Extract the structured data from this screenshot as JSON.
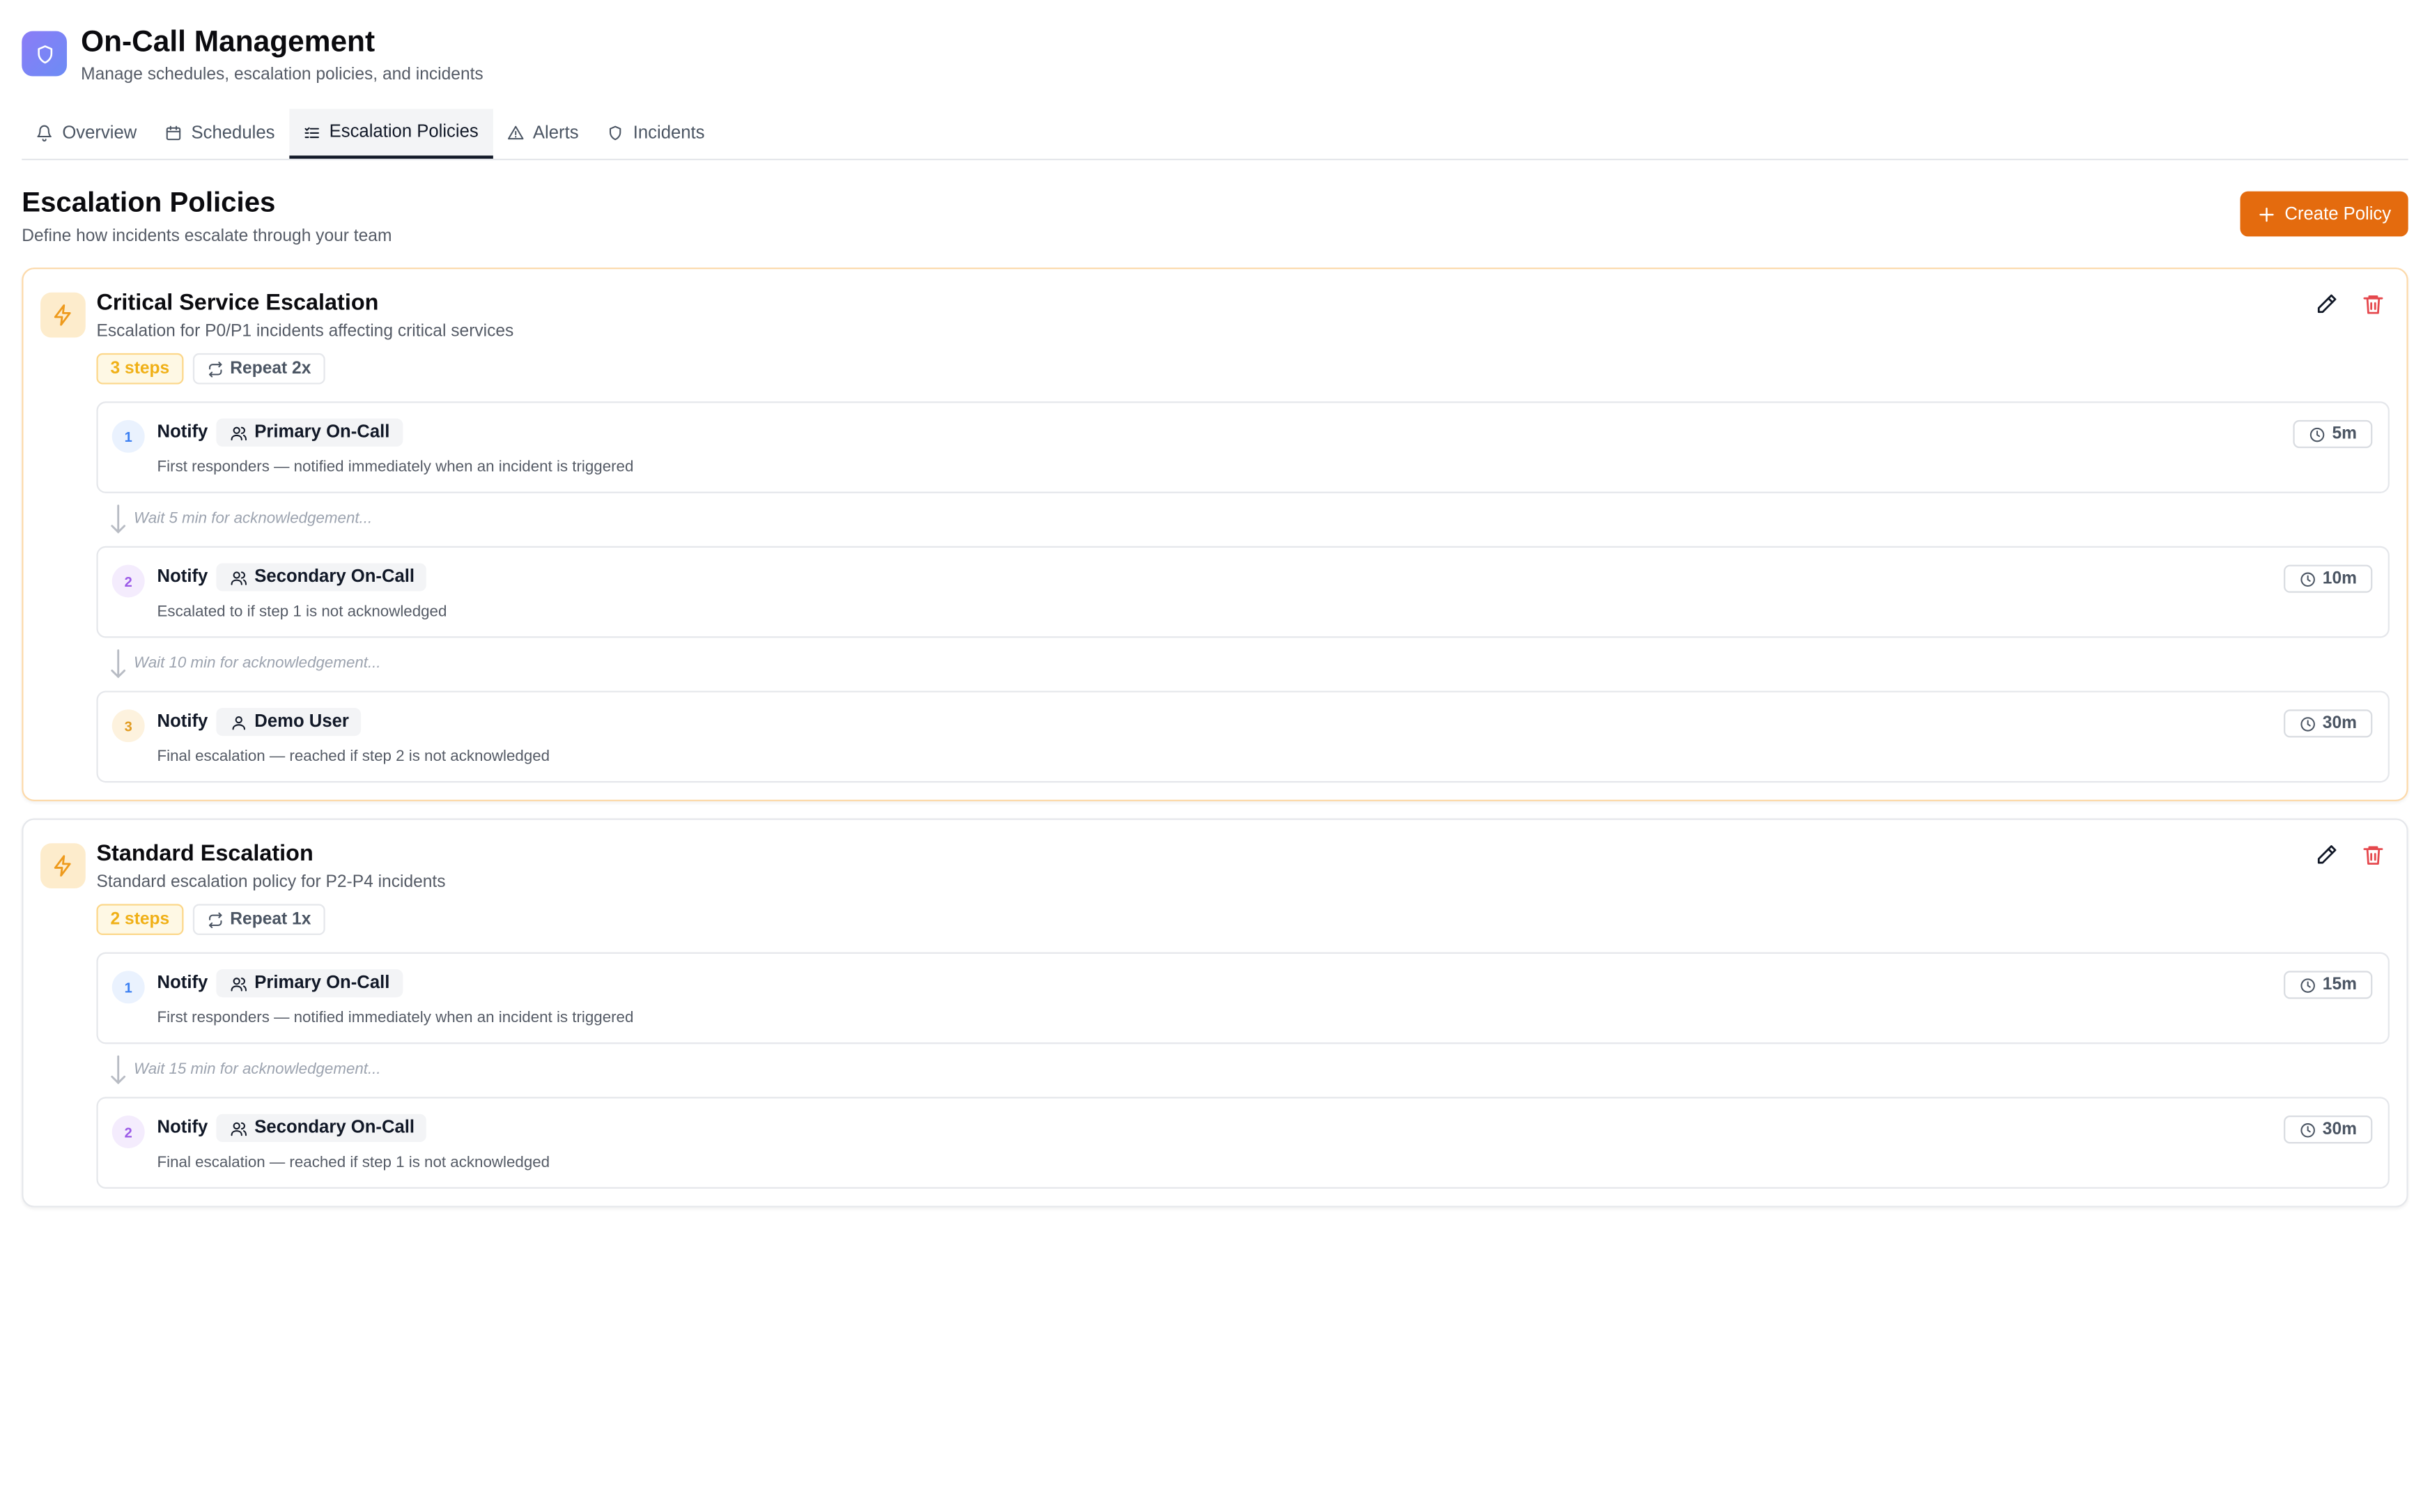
{
  "app": {
    "title": "On-Call Management",
    "subtitle": "Manage schedules, escalation policies, and incidents",
    "logo_icon": "shield-icon",
    "accent": "#e46b0e"
  },
  "tabs": [
    {
      "label": "Overview",
      "icon": "bell-icon"
    },
    {
      "label": "Schedules",
      "icon": "calendar-icon"
    },
    {
      "label": "Escalation Policies",
      "icon": "list-icon",
      "active": true
    },
    {
      "label": "Alerts",
      "icon": "warning-icon"
    },
    {
      "label": "Incidents",
      "icon": "shield-icon"
    }
  ],
  "section": {
    "title": "Escalation Policies",
    "subtitle": "Define how incidents escalate through your team",
    "create_label": "Create Policy"
  },
  "policies": [
    {
      "name": "Critical Service Escalation",
      "description": "Escalation for P0/P1 incidents affecting critical services",
      "steps_badge": "3 steps",
      "repeat_badge": "Repeat 2x",
      "steps": [
        {
          "num": "1",
          "action": "Notify",
          "target": "Primary On-Call",
          "target_icon": "users-icon",
          "desc": "First responders — notified immediately when an incident is triggered",
          "time": "5m"
        },
        {
          "wait": "Wait 5 min for acknowledgement..."
        },
        {
          "num": "2",
          "action": "Notify",
          "target": "Secondary On-Call",
          "target_icon": "users-icon",
          "desc": "Escalated to if step 1 is not acknowledged",
          "time": "10m"
        },
        {
          "wait": "Wait 10 min for acknowledgement..."
        },
        {
          "num": "3",
          "action": "Notify",
          "target": "Demo User",
          "target_icon": "user-icon",
          "desc": "Final escalation — reached if step 2 is not acknowledged",
          "time": "30m"
        }
      ]
    },
    {
      "name": "Standard Escalation",
      "description": "Standard escalation policy for P2-P4 incidents",
      "steps_badge": "2 steps",
      "repeat_badge": "Repeat 1x",
      "steps": [
        {
          "num": "1",
          "action": "Notify",
          "target": "Primary On-Call",
          "target_icon": "users-icon",
          "desc": "First responders — notified immediately when an incident is triggered",
          "time": "15m"
        },
        {
          "wait": "Wait 15 min for acknowledgement..."
        },
        {
          "num": "2",
          "action": "Notify",
          "target": "Secondary On-Call",
          "target_icon": "users-icon",
          "desc": "Final escalation — reached if step 1 is not acknowledged",
          "time": "30m"
        }
      ]
    }
  ]
}
